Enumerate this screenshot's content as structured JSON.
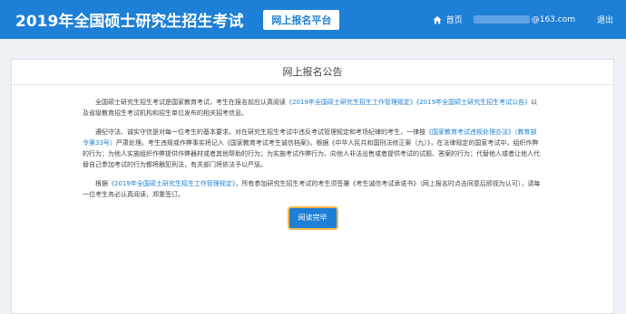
{
  "header": {
    "site_title": "2019年全国硕士研究生招生考试",
    "platform_badge": "网上报名平台",
    "home_label": "首页",
    "email_suffix": "@163.com",
    "logout_label": "退出"
  },
  "notice": {
    "title": "网上报名公告",
    "p1_a": "全国硕士研究生招生考试是国家教育考试，考生在报名前应认真阅读",
    "p1_link1": "《2019年全国硕士研究生招生工作管理规定》",
    "p1_link2": "《2019年全国硕士研究生招生考试公告》",
    "p1_b": "以及省级教育招生考试机构和招生单位发布的相关招考信息。",
    "p2_a": "遵纪守法、诚实守信是对每一位考生的基本要求。对在研究生招生考试中违反考试管理规定和考场纪律的考生，一律按",
    "p2_link1": "《国家教育考试违规处理办法》（教育部令第33号）",
    "p2_b": "严肃处理。考生违规或作弊事实将记入《国家教育考试考生诚信档案》。根据《中华人民共和国刑法修正案（九）》，在法律规定的国家考试中，组织作弊的行为；为他人实施组织作弊提供作弊器材或者其他帮助的行为；为实施考试作弊行为，向他人非法出售或者提供考试的试题、答案的行为；代替他人或者让他人代替自己参加考试的行为都将触犯刑法，有关部门将依法予以严惩。",
    "p3_a": "根据",
    "p3_link1": "《2019年全国硕士研究生招生工作管理规定》",
    "p3_b": "，所有参加研究生招生考试的考生须签署《考生诚信考试承诺书》（网上报名时点击同意后即视为认可），请每一位考生务必认真阅读，郑重签订。",
    "read_button": "阅读完毕"
  },
  "colors": {
    "accent": "#1e7fd6",
    "button_outline": "#f2b84b"
  }
}
